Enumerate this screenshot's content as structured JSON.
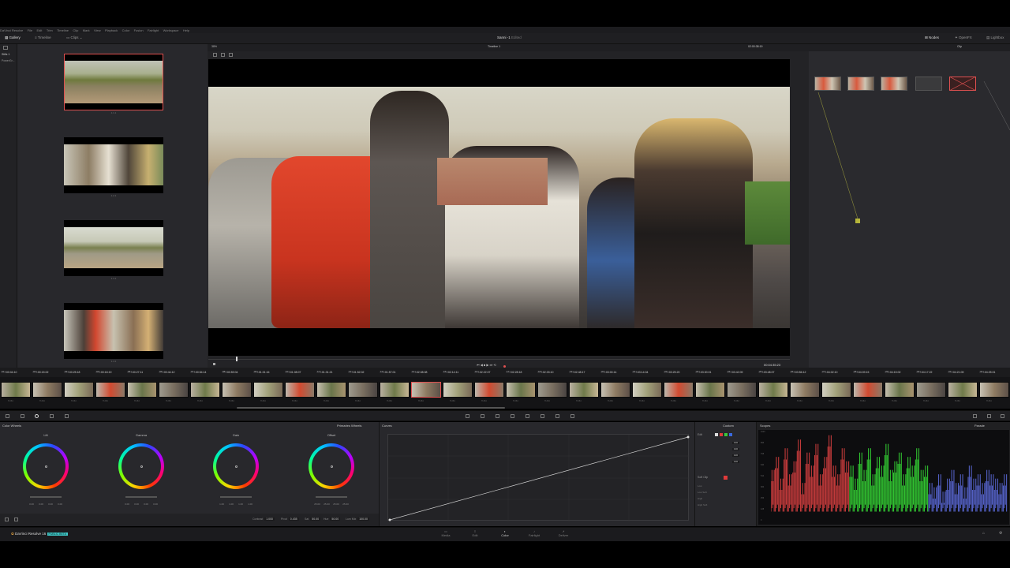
{
  "menubar": {
    "items": [
      "DaVinci Resolve",
      "File",
      "Edit",
      "Trim",
      "Timeline",
      "Clip",
      "Mark",
      "View",
      "Playback",
      "Color",
      "Fusion",
      "Fairlight",
      "Workspace",
      "Help"
    ]
  },
  "toolbar": {
    "gallery": "Gallery",
    "timeline": "Timeline",
    "clips": "Clips",
    "project_title": "Sanni -1",
    "project_status": "Edited",
    "nodes": "Nodes",
    "openfx": "OpenFX",
    "lightbox": "Lightbox"
  },
  "gallery": {
    "tree_items": [
      "Stills 1",
      "PowerGr..."
    ],
    "stills": [
      {
        "label": "1.1.1",
        "selected": true
      },
      {
        "label": "1.2.1",
        "selected": false
      },
      {
        "label": "1.3.1",
        "selected": false
      },
      {
        "label": "1.4.1",
        "selected": false
      }
    ]
  },
  "viewer": {
    "zoom": "38%",
    "timeline_name": "Timeline 1",
    "source_timecode": "02:00:38:19",
    "mode": "Clip",
    "playhead_timecode": "00:04:35:23"
  },
  "timeline": {
    "clip_timecodes": [
      "02:00:04:10",
      "02:00:15:02",
      "02:00:25:18",
      "02:00:18:19",
      "02:00:27:11",
      "02:00:44:12",
      "02:00:54:14",
      "02:00:59:04",
      "02:01:01:16",
      "02:01:08:07",
      "02:01:31:21",
      "02:01:52:02",
      "02:01:57:01",
      "02:02:08:08",
      "02:02:14:11",
      "02:02:22:07",
      "02:02:28:18",
      "02:02:33:10",
      "02:02:48:17",
      "02:03:00:14",
      "02:03:14:04",
      "02:03:25:20",
      "02:03:30:01",
      "02:03:42:09",
      "02:03:48:07",
      "02:03:56:12",
      "02:04:02:10",
      "02:04:09:15",
      "02:04:15:02",
      "02:04:17:22",
      "02:04:21:09",
      "02:04:25:01"
    ],
    "clip_codec": "H.264",
    "active_clip_index": 13
  },
  "color_wheels": {
    "title": "Color Wheels",
    "mode": "Primaries Wheels",
    "wheels": [
      {
        "name": "Lift",
        "values": [
          "0.00",
          "0.00",
          "0.00",
          "0.00"
        ]
      },
      {
        "name": "Gamma",
        "values": [
          "0.00",
          "0.00",
          "0.00",
          "0.00"
        ]
      },
      {
        "name": "Gain",
        "values": [
          "1.00",
          "1.00",
          "1.00",
          "1.00"
        ]
      },
      {
        "name": "Offset",
        "values": [
          "25.00",
          "25.00",
          "25.00",
          "25.00"
        ]
      }
    ],
    "params": {
      "contrast_label": "Contrast",
      "contrast": "1.000",
      "pivot_label": "Pivot",
      "pivot": "0.435",
      "sat_label": "Sat",
      "sat": "50.00",
      "hue_label": "Hue",
      "hue": "50.00",
      "lum_mix_label": "Lum Mix",
      "lum_mix": "100.00"
    }
  },
  "curves": {
    "title": "Curves",
    "mode": "Custom",
    "edit_label": "Edit",
    "intensity": [
      "100",
      "100",
      "100",
      "100"
    ],
    "soft_clip_label": "Soft Clip",
    "soft_clip_fields": [
      "Low",
      "Low Soft",
      "High",
      "High Soft"
    ]
  },
  "scopes": {
    "title": "Scopes",
    "mode": "Parade",
    "scale": [
      "1023",
      "896",
      "768",
      "640",
      "512",
      "384",
      "256",
      "128",
      "0"
    ],
    "colors": {
      "red": "#ff4a4a",
      "green": "#3cff3c",
      "blue": "#6a7bff"
    }
  },
  "footer": {
    "app_name": "DaVinci Resolve 16",
    "badge": "PUBLIC BETA",
    "pages": [
      "Media",
      "Edit",
      "Color",
      "Fairlight",
      "Deliver"
    ],
    "active_page": "Color"
  },
  "colors": {
    "accent_red": "#e05050",
    "badge_teal": "#3ec6c6"
  }
}
